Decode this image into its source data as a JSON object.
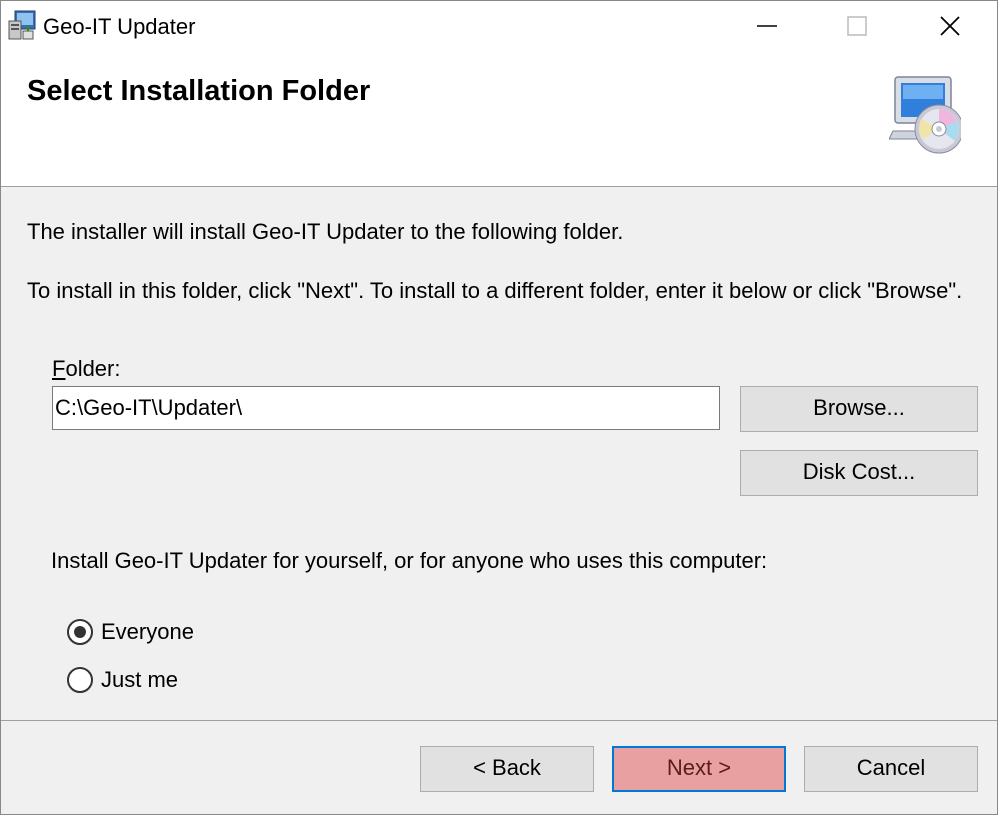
{
  "window": {
    "title": "Geo-IT Updater",
    "icon": "installer-app-icon"
  },
  "title_controls": {
    "minimize": "minimize-icon",
    "maximize": "maximize-icon",
    "close": "close-icon"
  },
  "banner": {
    "title": "Select Installation Folder",
    "icon": "computer-cd-icon"
  },
  "body": {
    "line1": "The installer will install Geo-IT Updater to the following folder.",
    "line2": "To install in this folder, click \"Next\". To install to a different folder, enter it below or click \"Browse\"."
  },
  "folder": {
    "label_mnemonic": "F",
    "label_rest": "older:",
    "value": "C:\\Geo-IT\\Updater\\",
    "browse_label": "Browse...",
    "disk_cost_label": "Disk Cost..."
  },
  "install_for": {
    "prompt": "Install Geo-IT Updater for yourself, or for anyone who uses this computer:",
    "options": [
      {
        "label": "Everyone",
        "selected": true
      },
      {
        "label": "Just me",
        "selected": false
      }
    ]
  },
  "footer": {
    "back_label": "< Back",
    "next_label": "Next >",
    "cancel_label": "Cancel"
  },
  "colors": {
    "dialog_bg": "#f0f0f0",
    "header_bg": "#ffffff",
    "button_bg": "#e1e1e1",
    "next_button_bg": "#e8a0a0",
    "focus_border": "#0078d7"
  }
}
